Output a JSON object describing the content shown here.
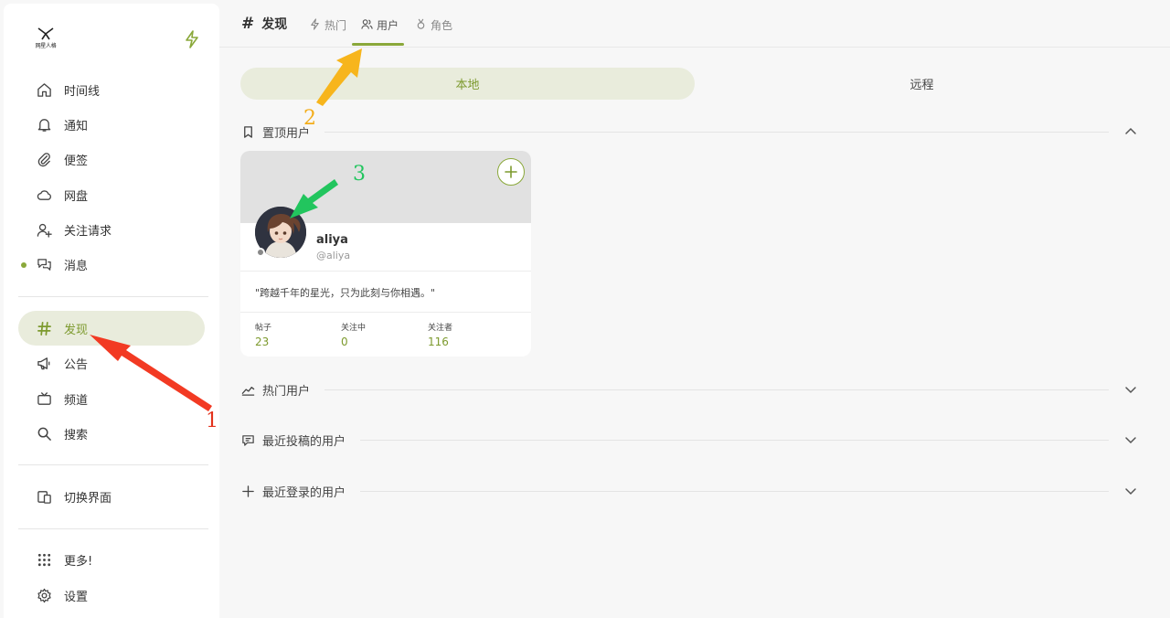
{
  "app": {
    "logo_text": "网星人格",
    "accent": "#8aa83a"
  },
  "sidebar": {
    "items": [
      {
        "label": "时间线",
        "icon": "home-icon"
      },
      {
        "label": "通知",
        "icon": "bell-icon"
      },
      {
        "label": "便签",
        "icon": "paperclip-icon"
      },
      {
        "label": "网盘",
        "icon": "cloud-icon"
      },
      {
        "label": "关注请求",
        "icon": "user-plus-icon"
      },
      {
        "label": "消息",
        "icon": "chat-icon"
      },
      {
        "label": "发现",
        "icon": "hash-icon",
        "active": true
      },
      {
        "label": "公告",
        "icon": "megaphone-icon"
      },
      {
        "label": "频道",
        "icon": "tv-icon"
      },
      {
        "label": "搜索",
        "icon": "search-icon"
      },
      {
        "label": "切换界面",
        "icon": "devices-icon"
      },
      {
        "label": "更多!",
        "icon": "grid-icon"
      },
      {
        "label": "设置",
        "icon": "gear-icon"
      }
    ]
  },
  "header": {
    "hash": "#",
    "title": "发现",
    "tabs": [
      {
        "label": "热门",
        "icon": "bolt-icon"
      },
      {
        "label": "用户",
        "icon": "users-icon",
        "active": true
      },
      {
        "label": "角色",
        "icon": "badge-icon"
      }
    ]
  },
  "segment": {
    "local": "本地",
    "remote": "远程",
    "selected": "本地"
  },
  "sections": {
    "pinned": "置顶用户",
    "popular": "热门用户",
    "recent_posted": "最近投稿的用户",
    "recent_login": "最近登录的用户"
  },
  "user_card": {
    "name": "aliya",
    "handle": "@aliya",
    "bio": "\"跨越千年的星光，只为此刻与你相遇。\"",
    "stats": [
      {
        "label": "帖子",
        "value": "23"
      },
      {
        "label": "关注中",
        "value": "0"
      },
      {
        "label": "关注者",
        "value": "116"
      }
    ]
  },
  "annotations": {
    "one": "1",
    "two": "2",
    "three": "3"
  }
}
